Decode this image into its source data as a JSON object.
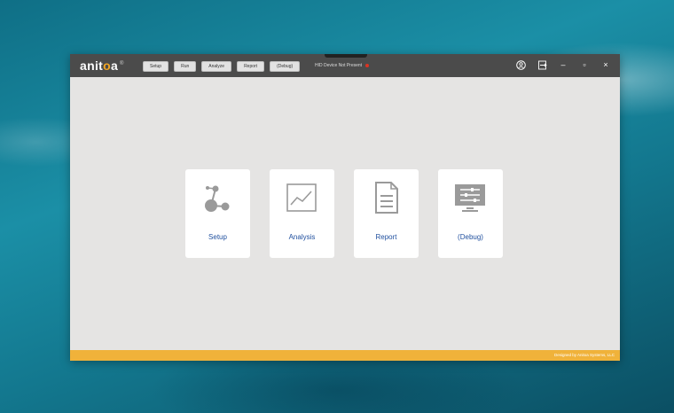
{
  "app": {
    "logo_text_main": "anit",
    "logo_text_accent": "o",
    "logo_text_end": "a",
    "logo_mark": "®"
  },
  "toolbar": {
    "buttons": [
      {
        "label": "Setup"
      },
      {
        "label": "Run"
      },
      {
        "label": "Analyze"
      },
      {
        "label": "Report"
      },
      {
        "label": "(Debug)"
      }
    ]
  },
  "status": {
    "text": "HID Device Not Present",
    "indicator_color": "#dd3322"
  },
  "window_controls": {
    "icons": [
      "user-icon",
      "exit-icon",
      "minimize-icon",
      "maximize-icon",
      "close-icon"
    ],
    "minimize": "–",
    "maximize": "▫",
    "close": "×"
  },
  "cards": [
    {
      "label": "Setup",
      "icon": "setup-nodes-icon"
    },
    {
      "label": "Analysis",
      "icon": "line-chart-icon"
    },
    {
      "label": "Report",
      "icon": "document-icon"
    },
    {
      "label": "(Debug)",
      "icon": "monitor-sliders-icon"
    }
  ],
  "footer": {
    "credit": "Designed by Anitoa Systems, LLC",
    "color": "#f0b23a"
  },
  "colors": {
    "titlebar": "#4b4b4b",
    "card_label": "#1f4f9e",
    "icon_gray": "#9a9a9a"
  }
}
